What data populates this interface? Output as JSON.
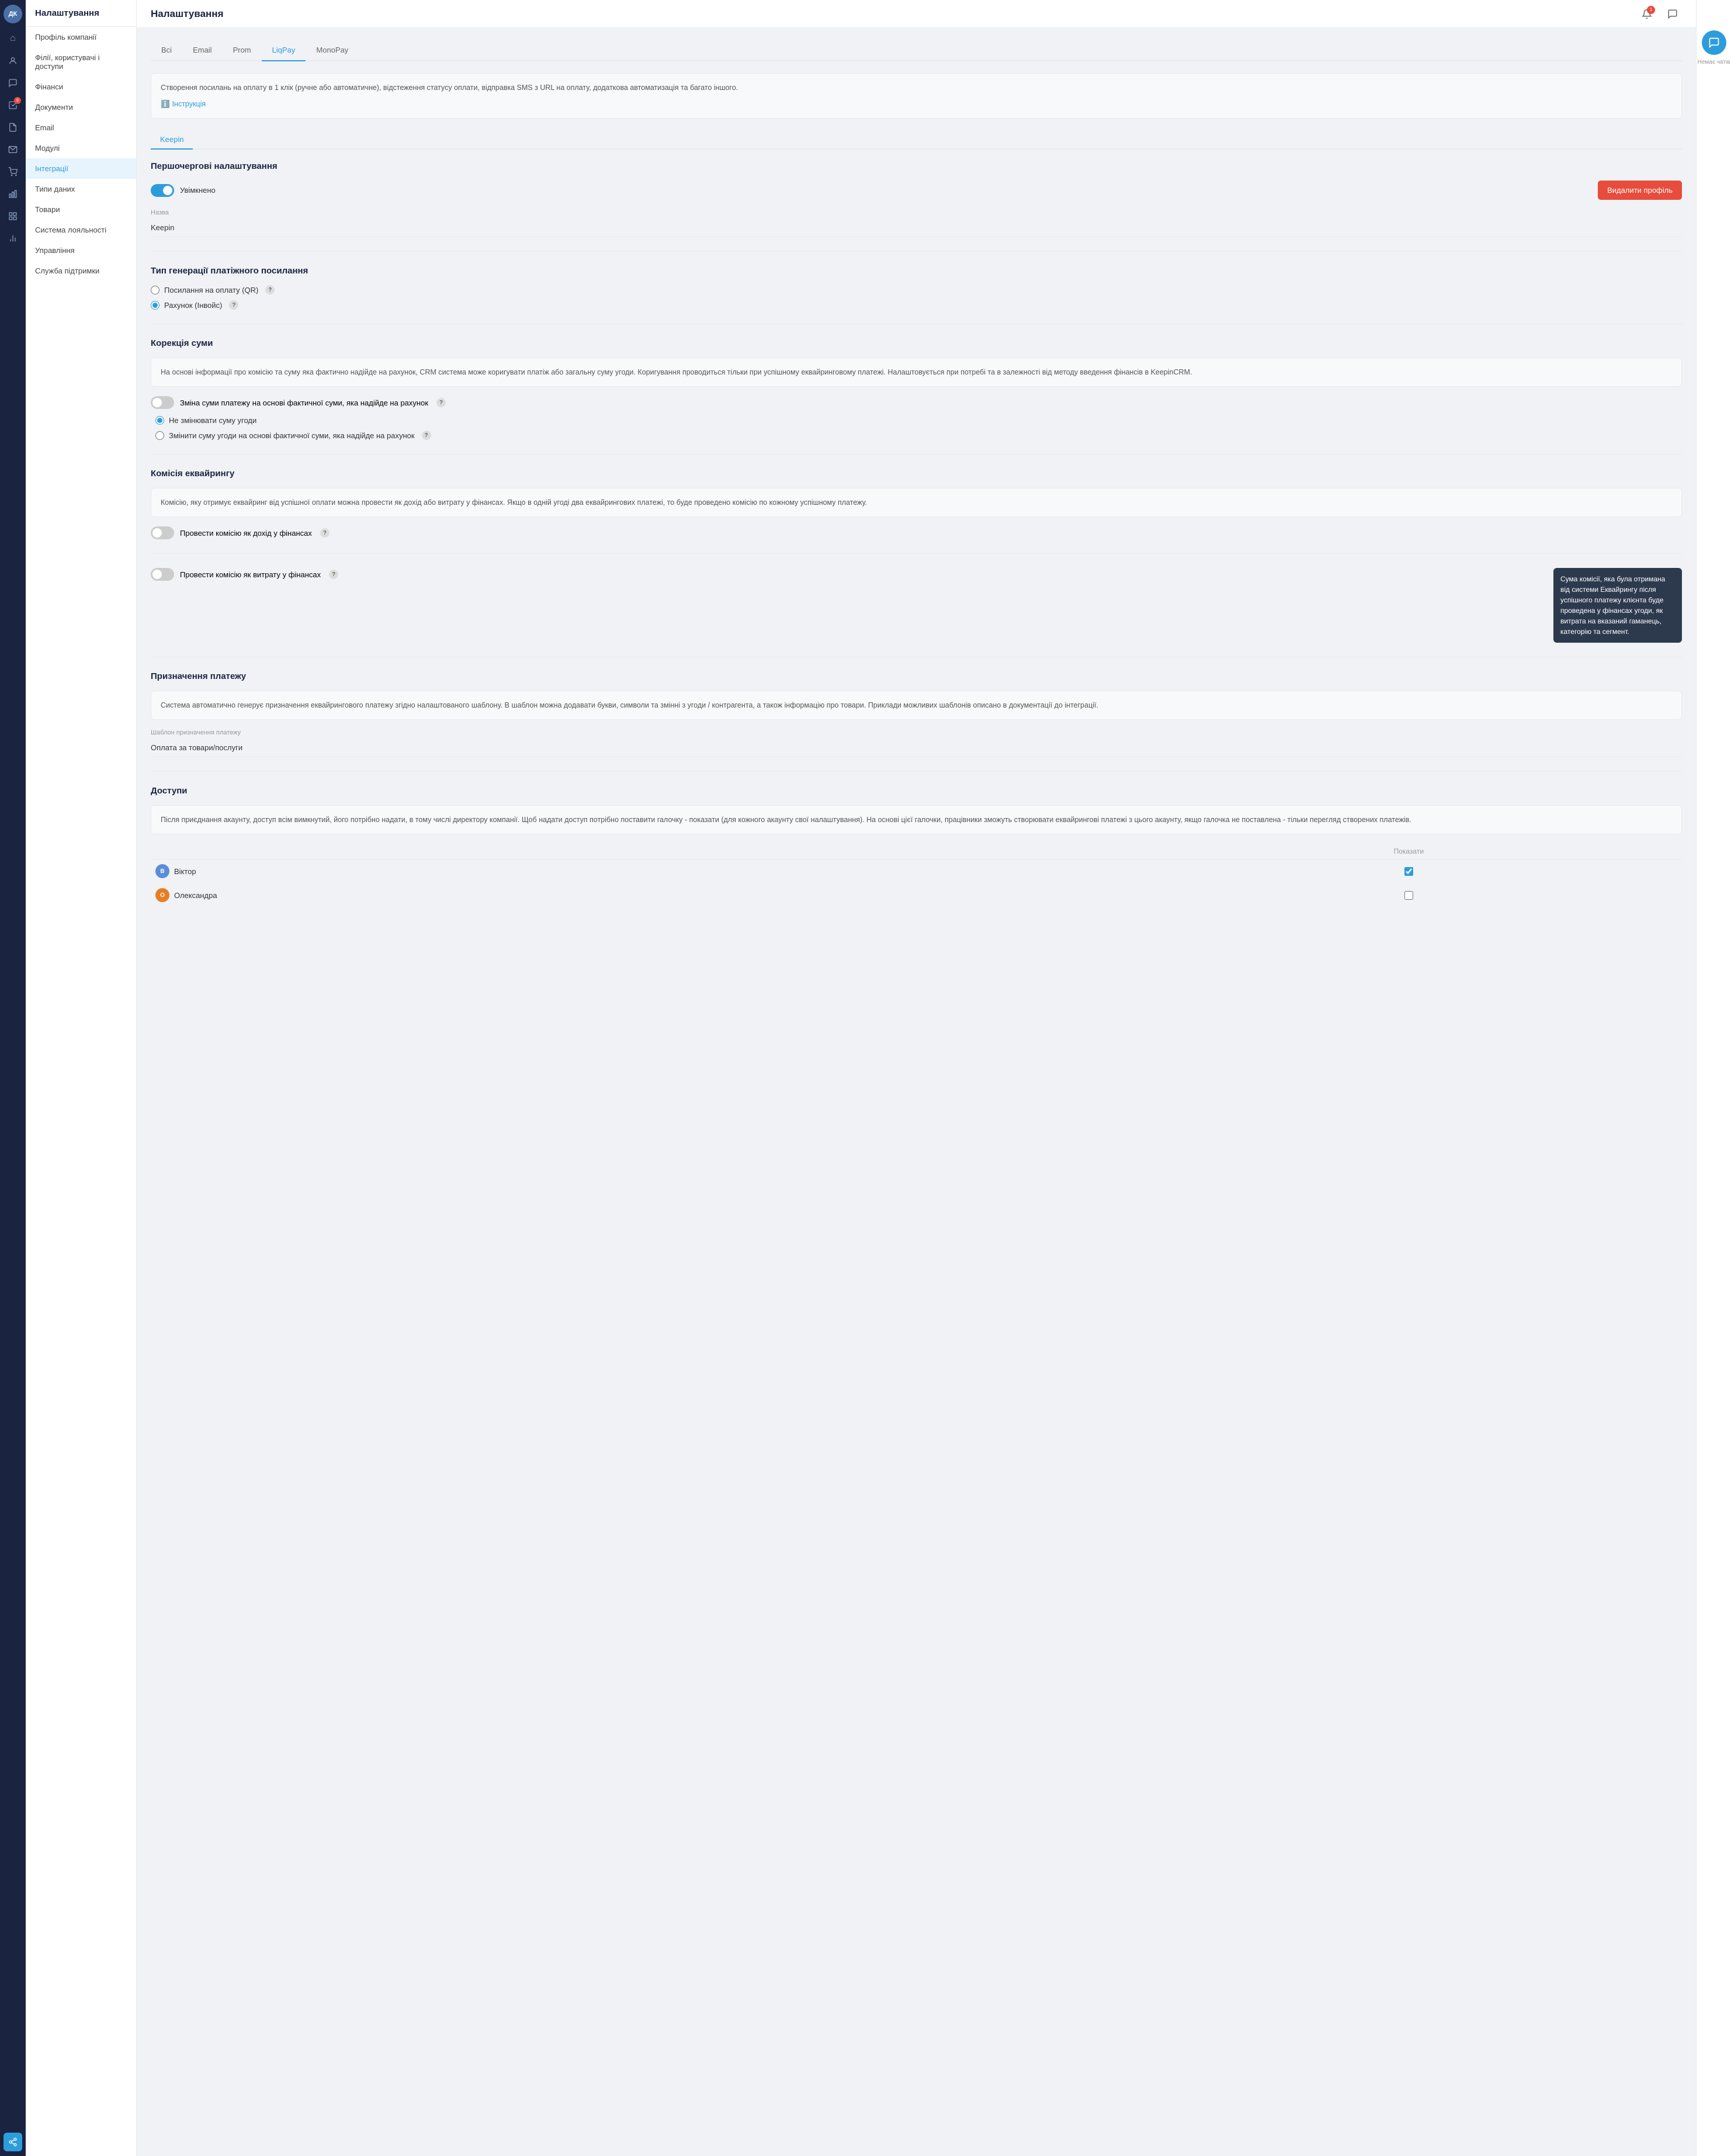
{
  "app": {
    "title": "Налаштування"
  },
  "iconBar": {
    "avatar": "ДК",
    "icons": [
      {
        "name": "home-icon",
        "symbol": "⌂",
        "active": false
      },
      {
        "name": "contacts-icon",
        "symbol": "👤",
        "active": false
      },
      {
        "name": "chat-icon",
        "symbol": "💬",
        "active": false
      },
      {
        "name": "tasks-icon",
        "symbol": "✓",
        "active": false,
        "badge": "9"
      },
      {
        "name": "docs-icon",
        "symbol": "📄",
        "active": false
      },
      {
        "name": "cart-icon",
        "symbol": "🛒",
        "active": false
      },
      {
        "name": "analytics-icon",
        "symbol": "📊",
        "active": false
      },
      {
        "name": "layers-icon",
        "symbol": "⬛",
        "active": false
      },
      {
        "name": "reports-icon",
        "symbol": "📈",
        "active": false
      },
      {
        "name": "settings-icon",
        "symbol": "⚙",
        "active": true
      }
    ]
  },
  "sidebar": {
    "title": "Налаштування",
    "items": [
      {
        "label": "Профіль компанії",
        "active": false
      },
      {
        "label": "Філії, користувачі і доступи",
        "active": false
      },
      {
        "label": "Фінанси",
        "active": false
      },
      {
        "label": "Документи",
        "active": false
      },
      {
        "label": "Email",
        "active": false
      },
      {
        "label": "Модулі",
        "active": false
      },
      {
        "label": "Інтеграції",
        "active": true
      },
      {
        "label": "Типи даних",
        "active": false
      },
      {
        "label": "Товари",
        "active": false
      },
      {
        "label": "Система лояльності",
        "active": false
      },
      {
        "label": "Управління",
        "active": false
      },
      {
        "label": "Служба підтримки",
        "active": false
      }
    ]
  },
  "tabs": {
    "items": [
      {
        "label": "Всі",
        "active": false
      },
      {
        "label": "Email",
        "active": false
      },
      {
        "label": "Prom",
        "active": false
      },
      {
        "label": "LiqPay",
        "active": true
      },
      {
        "label": "MonoPay",
        "active": false
      }
    ]
  },
  "infoBox": {
    "text": "Створення посилань на оплату в 1 клік (ручне або автоматичне), відстеження статусу оплати, відправка SMS з URL на оплату, додаткова автоматизація та багато іншого.",
    "linkText": "Інструкція",
    "linkIcon": "ℹ"
  },
  "subTabs": {
    "items": [
      {
        "label": "Keepin",
        "active": true
      }
    ]
  },
  "primarySettings": {
    "title": "Першочергові налаштування",
    "toggle": {
      "enabled": true,
      "label": "Увімкнено"
    },
    "deleteButton": "Видалити профіль",
    "nameLabel": "Назва",
    "nameValue": "Keepin"
  },
  "paymentLinkType": {
    "title": "Тип генерації платіжного посилання",
    "options": [
      {
        "label": "Посилання на оплату (QR)",
        "selected": false
      },
      {
        "label": "Рахунок (Інвойс)",
        "selected": true
      }
    ],
    "questionMark": "?"
  },
  "amountCorrection": {
    "title": "Корекція суми",
    "description": "На основі інформації про комісію та суму яка фактично надійде на рахунок, CRM система може коригувати платіж або загальну суму угоди. Коригування проводиться тільки при успішному еквайринговому платежі. Налаштовується при потребі та в залежності від методу введення фінансів в KeepinCRM.",
    "toggles": [
      {
        "label": "Зміна суми платежу на основі фактичної суми, яка надійде на рахунок",
        "enabled": false
      },
      {
        "label": "Не змінювати суму угоди",
        "selected": true,
        "isRadio": true
      },
      {
        "label": "Змінити суму угоди на основі фактичної суми, яка надійде на рахунок",
        "selected": false,
        "isRadio": true
      }
    ],
    "questionMark": "?"
  },
  "acquiringCommission": {
    "title": "Комісія еквайрингу",
    "description": "Комісію, яку отримує еквайринг від успішної оплати можна провести як дохід або витрату у фінансах. Якщо в одній угоді два еквайрингових платежі, то буде проведено комісію по кожному успішному платежу.",
    "toggle1": {
      "label": "Провести комісію як дохід у фінансах",
      "enabled": false,
      "questionMark": "?"
    },
    "toggle2": {
      "label": "Провести комісію як витрату у фінансах",
      "enabled": false,
      "questionMark": "?"
    },
    "tooltip": {
      "text": "Сума комісії, яка була отримана від системи Еквайрингу після успішного платежу клієнта буде проведена у фінансах угоди, як витрата на вказаний гаманець, категорію та сегмент."
    }
  },
  "paymentPurpose": {
    "title": "Призначення платежу",
    "description": "Система автоматично генерує призначення еквайрингового платежу згідно налаштованого шаблону. В шаблон можна додавати букви, символи та змінні з угоди / контрагента, а також інформацію про товари. Приклади можливих шаблонів описано в документації до інтеграції.",
    "templateLabel": "Шаблон призначення платежу",
    "templateValue": "Оплата за товари/послуги"
  },
  "access": {
    "title": "Доступи",
    "description": "Після приєднання акаунту, доступ всім вимкнутий, його потрібно надати, в тому числі директору компанії. Щоб надати доступ потрібно поставити галочку - показати (для кожного акаунту свої налаштування). На основі цієї галочки, працівники зможуть створювати еквайрингові платежі з цього акаунту, якщо галочка не поставлена - тільки перегляд створених платежів.",
    "tableHeader": "Показати",
    "users": [
      {
        "name": "Віктор",
        "avatarBg": "#5b8dd9",
        "initials": "В",
        "checked": true
      },
      {
        "name": "Олександра",
        "avatarBg": "#e67e22",
        "initials": "О",
        "checked": false
      }
    ]
  },
  "rightPanel": {
    "chatLabel": "Немає чатів",
    "chatIcon": "💬"
  }
}
